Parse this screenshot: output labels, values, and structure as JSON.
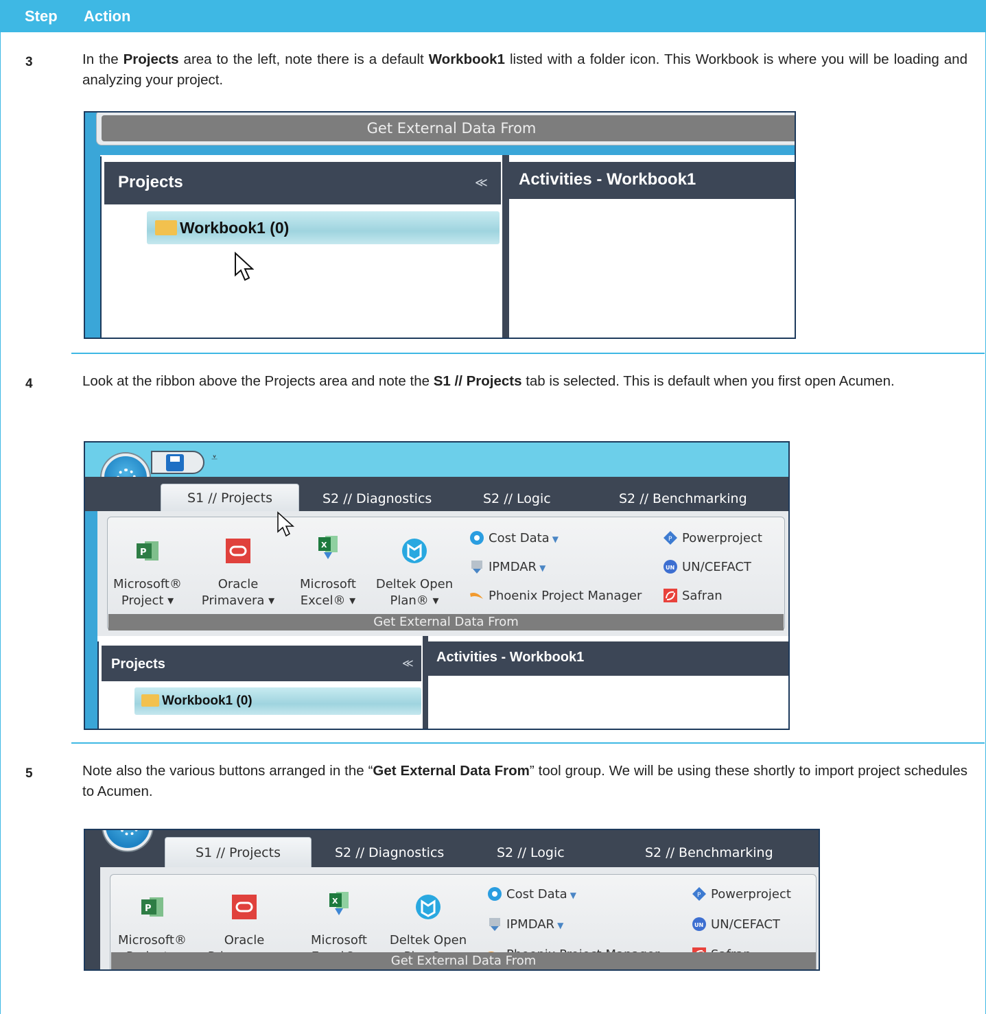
{
  "header": {
    "step": "Step",
    "action": "Action"
  },
  "steps": [
    {
      "number": "3",
      "text_parts": [
        "In the ",
        "Projects",
        " area to the left, note there is a default ",
        "Workbook1",
        " listed with a folder icon. This Workbook is where you will be loading and analyzing your project."
      ]
    },
    {
      "number": "4",
      "text_parts": [
        "Look at the ribbon above the Projects area and note the ",
        "S1 // Projects",
        " tab is selected. This is default when you first open Acumen."
      ]
    },
    {
      "number": "5",
      "text_parts": [
        "Note also the various buttons arranged in the “",
        "Get External Data From",
        "” tool group. We will be using these shortly to import project schedules to Acumen."
      ]
    }
  ],
  "app": {
    "group_label": "Get External Data From",
    "projects_title": "Projects",
    "activities_title": "Activities - Workbook1",
    "workbook_item": "Workbook1 (0)",
    "tabs": [
      "S1 // Projects",
      "S2 // Diagnostics",
      "S2 // Logic",
      "S2 // Benchmarking"
    ],
    "big_buttons": [
      {
        "line1": "Microsoft®",
        "line2": "Project ▾",
        "icon": "ms-project-icon"
      },
      {
        "line1": "Oracle",
        "line2": "Primavera ▾",
        "icon": "oracle-icon"
      },
      {
        "line1": "Microsoft",
        "line2": "Excel® ▾",
        "icon": "ms-excel-icon"
      },
      {
        "line1": "Deltek Open",
        "line2": "Plan® ▾",
        "icon": "deltek-icon"
      }
    ],
    "small_buttons_col1": [
      "Cost Data",
      "IPMDAR",
      "Phoenix Project Manager"
    ],
    "small_buttons_col2": [
      "Powerproject",
      "UN/CEFACT",
      "Safran"
    ],
    "colors": {
      "header": "#3eb8e4",
      "dark_panel": "#3c4656",
      "ribbon_bg": "#3aa6d8",
      "dark_bar": "#3d4654"
    }
  }
}
